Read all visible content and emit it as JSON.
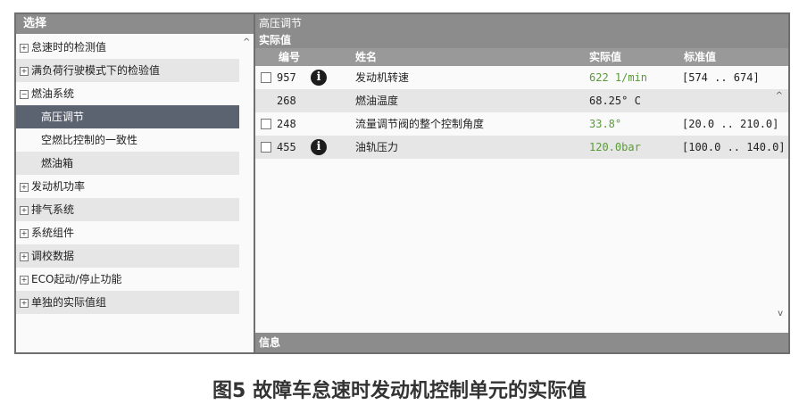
{
  "left_panel": {
    "header": "选择",
    "items": [
      {
        "toggle": "+",
        "label": "怠速时的检测值"
      },
      {
        "toggle": "+",
        "label": "满负荷行驶模式下的检验值"
      },
      {
        "toggle": "−",
        "label": "燃油系统"
      },
      {
        "toggle": "",
        "label": "高压调节"
      },
      {
        "toggle": "",
        "label": "空燃比控制的一致性"
      },
      {
        "toggle": "",
        "label": "燃油箱"
      },
      {
        "toggle": "+",
        "label": "发动机功率"
      },
      {
        "toggle": "+",
        "label": "排气系统"
      },
      {
        "toggle": "+",
        "label": "系统组件"
      },
      {
        "toggle": "+",
        "label": "调校数据"
      },
      {
        "toggle": "+",
        "label": "ECO起动/停止功能"
      },
      {
        "toggle": "+",
        "label": "单独的实际值组"
      }
    ]
  },
  "right_panel": {
    "title": "高压调节",
    "subtitle": "实际值",
    "columns": {
      "number": "编号",
      "name": "姓名",
      "actual": "实际值",
      "standard": "标准值"
    },
    "rows": [
      {
        "number": "957",
        "info": "i",
        "name": "发动机转速",
        "actual": "622 1/min",
        "standard": "[574 .. 674]"
      },
      {
        "number": "268",
        "info": "",
        "name": "燃油温度",
        "actual": "68.25° C",
        "standard": ""
      },
      {
        "number": "248",
        "info": "",
        "name": "流量调节阀的整个控制角度",
        "actual": "33.8°",
        "standard": "[20.0 .. 210.0]"
      },
      {
        "number": "455",
        "info": "i",
        "name": "油轨压力",
        "actual": "120.0bar",
        "standard": "[100.0 .. 140.0]"
      }
    ],
    "info_bar": "信息"
  },
  "caption": "图5 故障车怠速时发动机控制单元的实际值"
}
